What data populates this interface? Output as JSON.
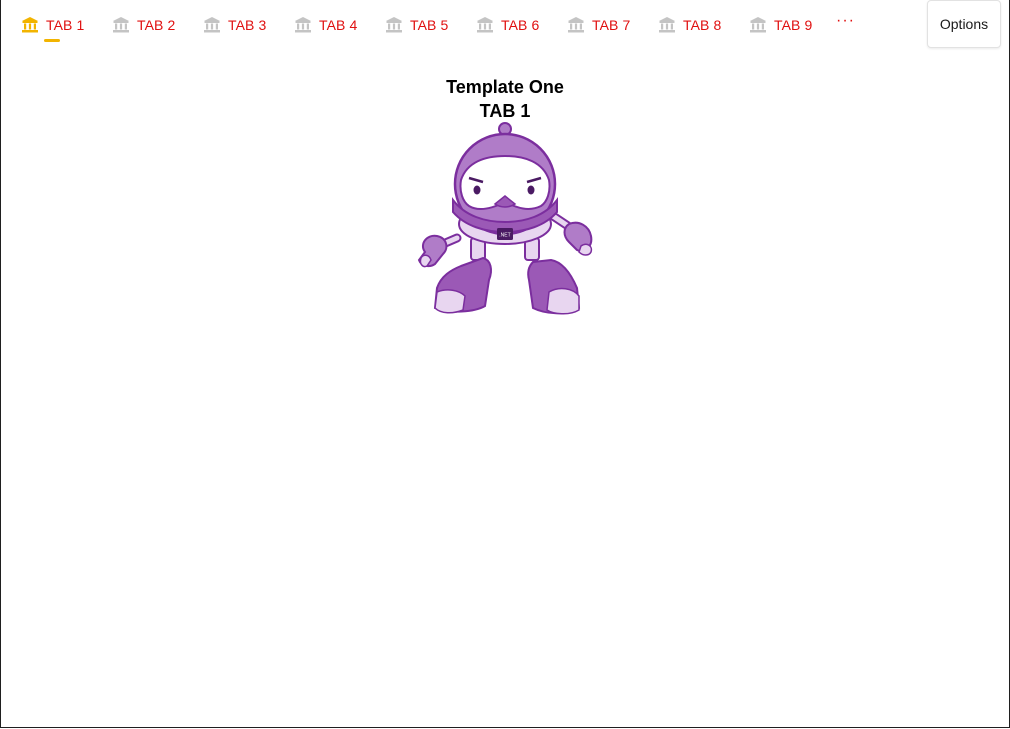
{
  "tabs": [
    {
      "label": "TAB 1",
      "selected": true
    },
    {
      "label": "TAB 2",
      "selected": false
    },
    {
      "label": "TAB 3",
      "selected": false
    },
    {
      "label": "TAB 4",
      "selected": false
    },
    {
      "label": "TAB 5",
      "selected": false
    },
    {
      "label": "TAB 6",
      "selected": false
    },
    {
      "label": "TAB 7",
      "selected": false
    },
    {
      "label": "TAB 8",
      "selected": false
    },
    {
      "label": "TAB 9",
      "selected": false
    }
  ],
  "more_label": "···",
  "options_label": "Options",
  "content": {
    "title": "Template One",
    "subtitle": "TAB 1",
    "image": "dotnet-bot robot illustration",
    "badge_text": ".NET"
  },
  "icons": {
    "tab_icon": "bank-building-icon",
    "selected_color": "#F2B400",
    "unselected_color": "#BDBDBD"
  },
  "colors": {
    "tab_text": "#E01010",
    "accent": "#F2B400",
    "robot_primary": "#9B59B6",
    "robot_dark": "#7B2E9E",
    "robot_light": "#E8D6F0"
  }
}
